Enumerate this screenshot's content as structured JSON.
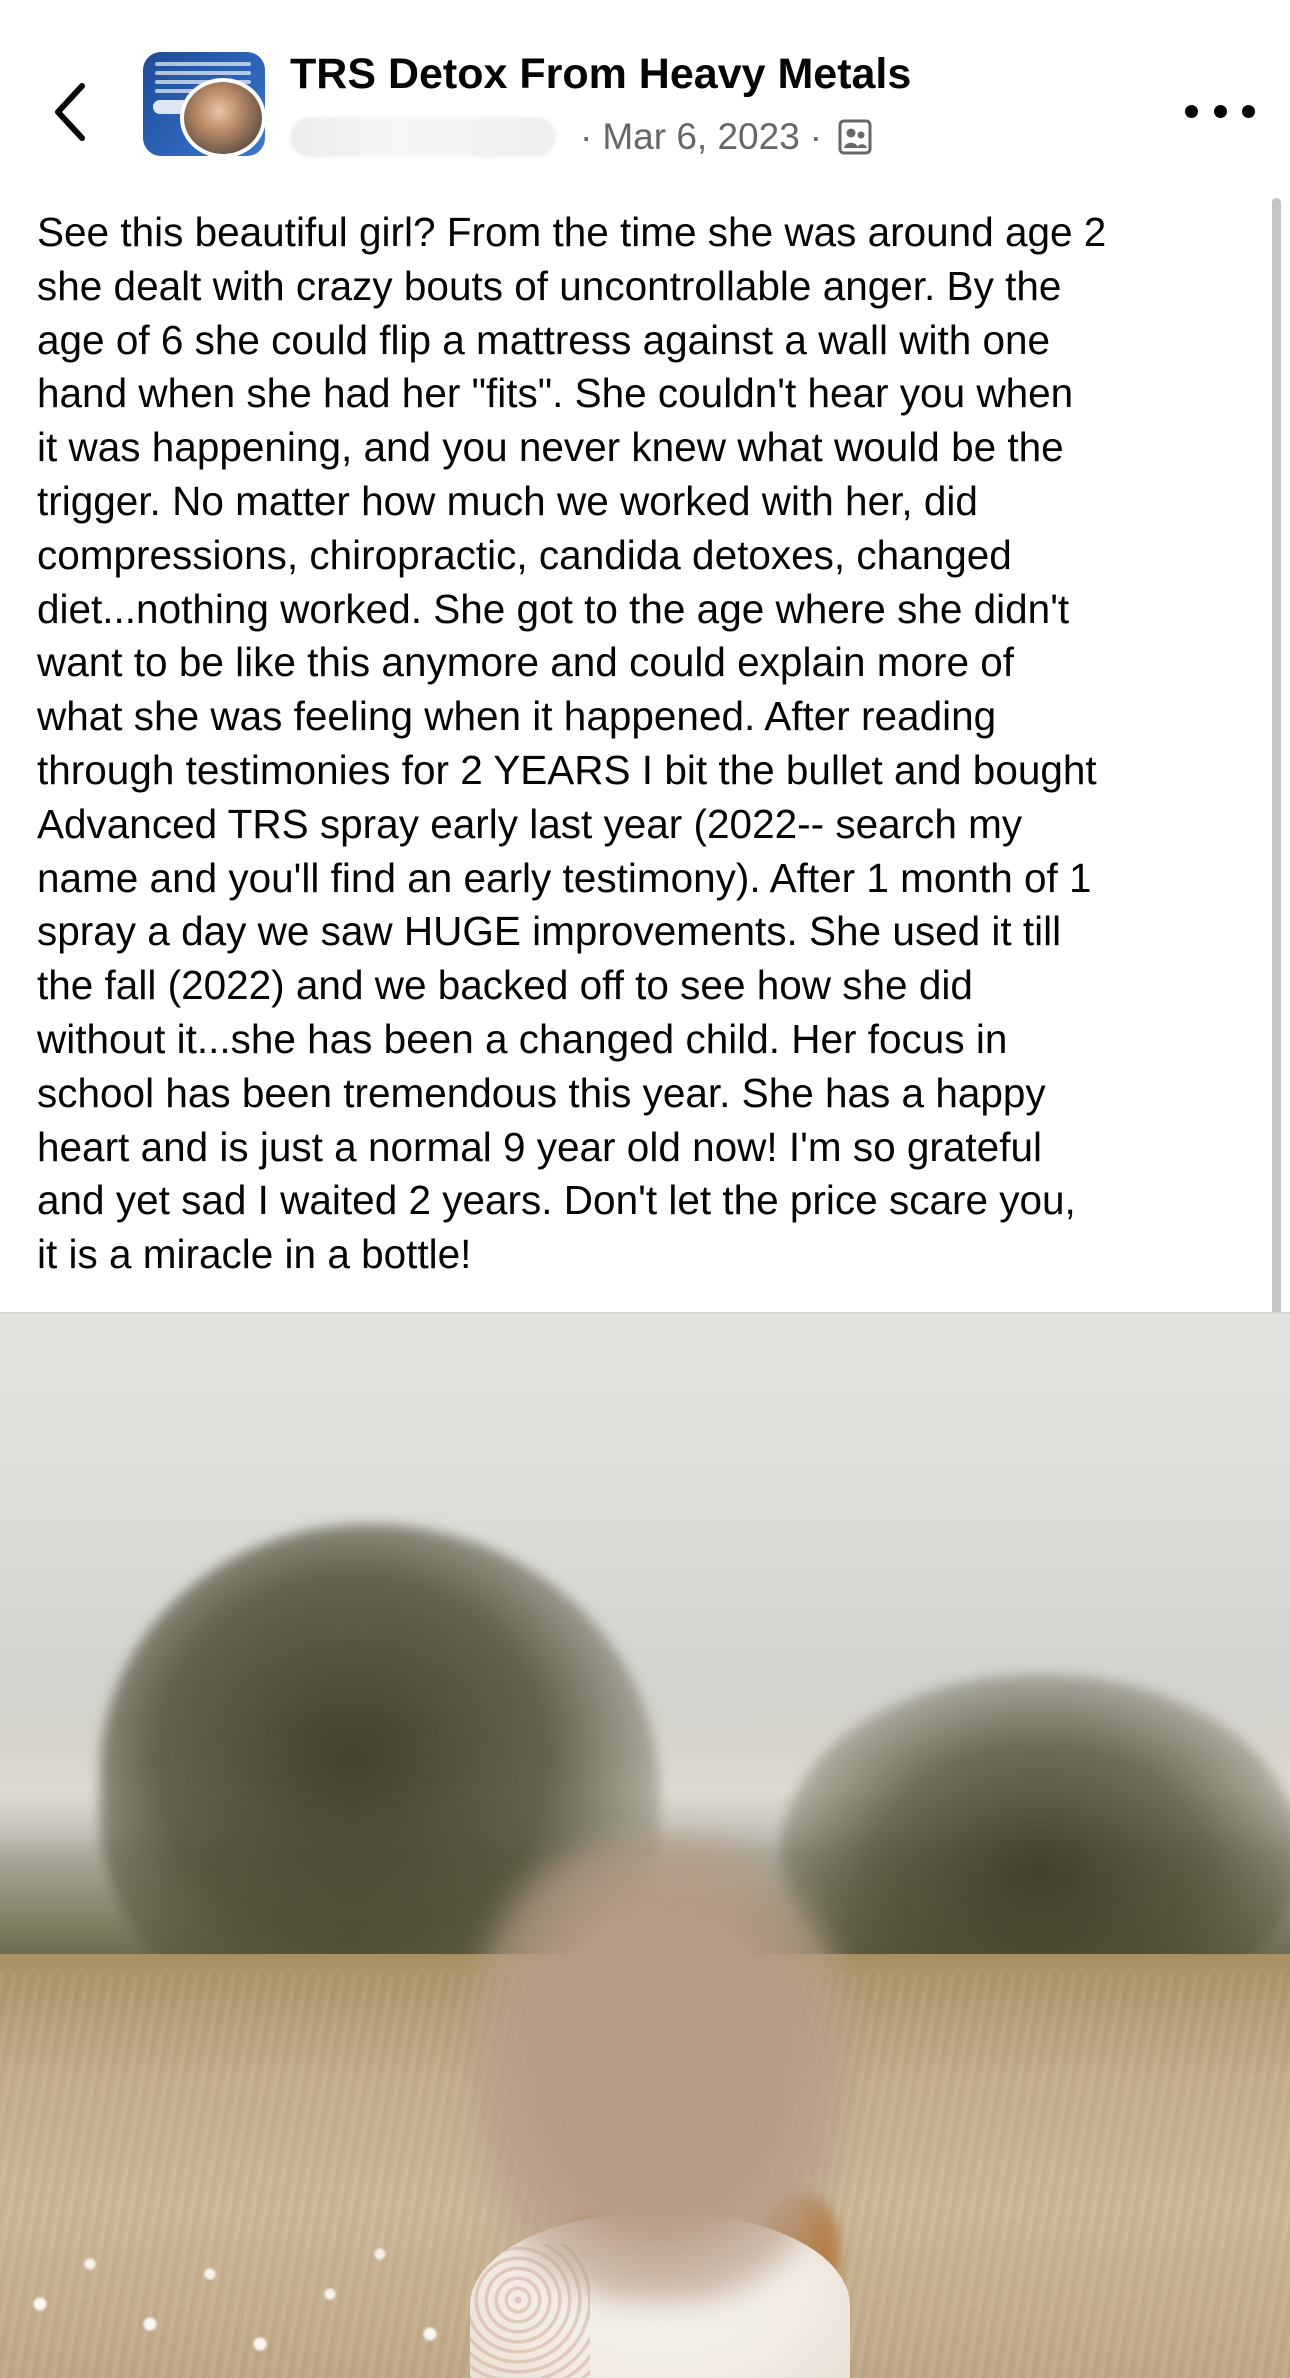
{
  "header": {
    "back_label": "",
    "group_name": "TRS Detox From Heavy Metals",
    "date": "Mar 6, 2023",
    "separator": "·",
    "audience_icon": "group-members-icon",
    "more_icon": "more-options-icon"
  },
  "post": {
    "text": "See this beautiful girl? From the time she was around age 2\nshe dealt with crazy bouts of uncontrollable anger. By the\nage of 6 she could flip a mattress against a wall with one\nhand when she had her \"fits\". She couldn't hear you when\nit was happening, and you never knew what would be the\ntrigger. No matter how much we worked with her, did\ncompressions, chiropractic, candida detoxes, changed\ndiet...nothing worked. She got to the age where she didn't\nwant to be like this anymore and could explain more of\nwhat she was feeling when it happened. After reading\nthrough testimonies for 2 YEARS I bit the bullet and bought\nAdvanced TRS spray early last year (2022-- search my\nname and you'll find an early testimony). After 1 month of 1\nspray a day we saw HUGE improvements. She used it till\nthe fall (2022) and we backed off to see how she did\nwithout it...she has been a changed child. Her focus in\nschool has been tremendous this year. She has a happy\nheart and is just a normal 9 year old now! I'm so grateful\nand yet sad I waited 2 years. Don't let the price scare you,\nit is a miracle in a bottle!"
  },
  "colors": {
    "text_primary": "#050505",
    "text_secondary": "#65676b",
    "background": "#ffffff",
    "scrollbar": "#c4c4c4"
  }
}
